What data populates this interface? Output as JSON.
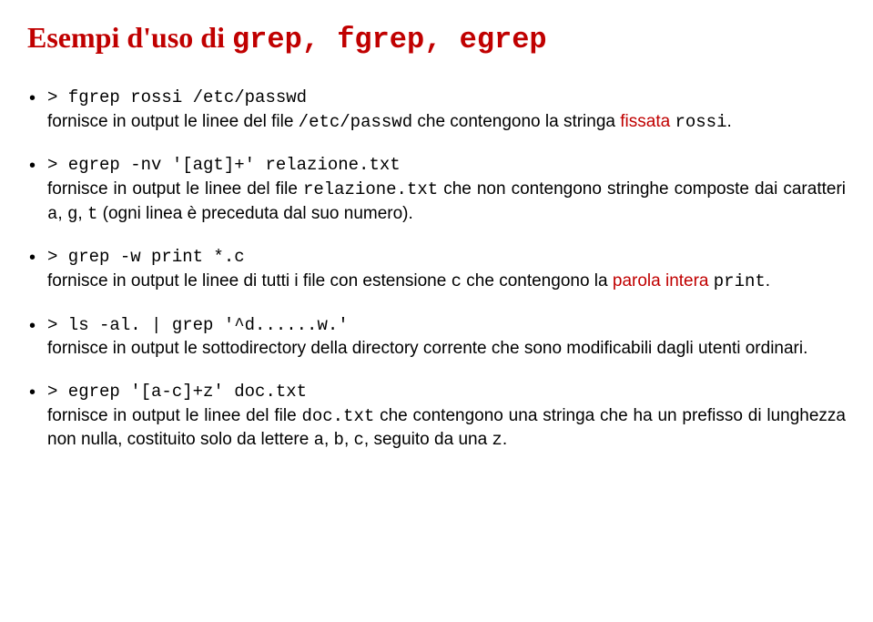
{
  "title_prefix": "Esempi d'uso di ",
  "title_mono": "grep, fgrep, egrep",
  "items": [
    {
      "cmd": "> fgrep rossi /etc/passwd",
      "d1": "fornisce in output le linee del file ",
      "m1": "/etc/passwd",
      "d2": " che contengono la stringa ",
      "r1": "fissata",
      "d3": " ",
      "m2": "rossi",
      "d4": "."
    },
    {
      "cmd": "> egrep -nv '[agt]+' relazione.txt",
      "d1": "fornisce in output le linee del file ",
      "m1": "relazione.txt",
      "d2": " che non contengono stringhe composte dai caratteri ",
      "m2": "a",
      "d3": ", ",
      "m3": "g",
      "d4": ", ",
      "m4": "t",
      "d5": " (ogni linea è preceduta dal suo numero)."
    },
    {
      "cmd": "> grep -w print *.c",
      "d1": "fornisce in output le linee di tutti i file con estensione ",
      "m1": "c",
      "d2": " che contengono la ",
      "r1": "parola intera",
      "d3": " ",
      "m2": "print",
      "d4": "."
    },
    {
      "cmd": "> ls -al. | grep '^d......w.'",
      "d1": "fornisce in output le sottodirectory della directory corrente che sono modificabili dagli utenti ordinari."
    },
    {
      "cmd": "> egrep '[a-c]+z' doc.txt",
      "d1": "fornisce in output le linee del file ",
      "m1": "doc.txt",
      "d2": " che contengono una stringa che ha un prefisso di lunghezza non nulla, costituito solo da lettere ",
      "m2": "a",
      "d3": ", ",
      "m3": "b",
      "d4": ", ",
      "m4": "c",
      "d5": ", seguito da una ",
      "m5": "z",
      "d6": "."
    }
  ]
}
